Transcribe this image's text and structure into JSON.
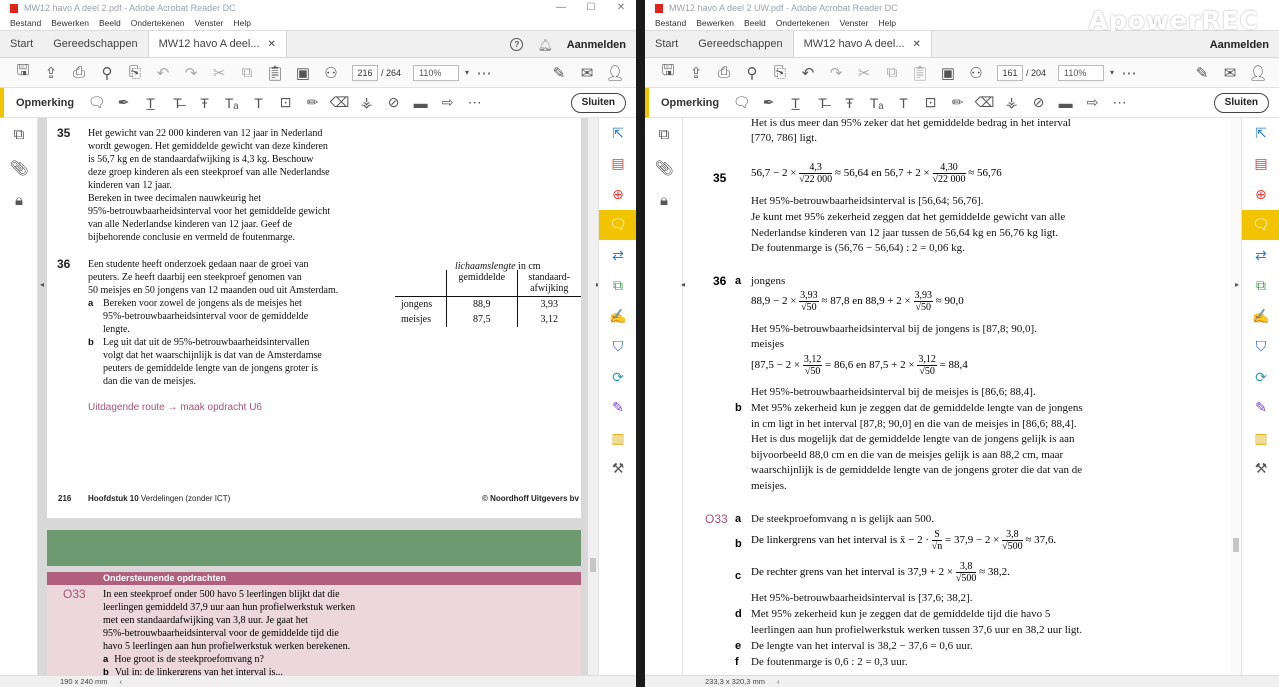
{
  "left_window": {
    "title": "MW12 havo A deel 2.pdf - Adobe Acrobat Reader DC",
    "menu": [
      "Bestand",
      "Bewerken",
      "Beeld",
      "Ondertekenen",
      "Venster",
      "Help"
    ],
    "tabs": {
      "start": "Start",
      "tools": "Gereedschappen",
      "doc": "MW12 havo A deel..."
    },
    "login": "Aanmelden",
    "page_current": "216",
    "page_total": "/ 264",
    "zoom": "110%",
    "annot_label": "Opmerking",
    "close_label": "Sluiten",
    "status_size": "190 x 240 mm",
    "page": {
      "q35_num": "35",
      "q35_text": [
        "Het gewicht van 22 000 kinderen van 12 jaar in Nederland",
        "wordt gewogen. Het gemiddelde gewicht van deze kinderen",
        "is 56,7 kg en de standaardafwijking is 4,3 kg. Beschouw",
        "deze groep kinderen als een steekproef van alle Nederlandse",
        "kinderen van 12 jaar.",
        "Bereken in twee decimalen nauwkeurig het",
        "95%-betrouwbaarheidsinterval voor het gemiddelde gewicht",
        "van alle Nederlandse kinderen van 12 jaar. Geef de",
        "bijbehorende conclusie en vermeld de foutenmarge."
      ],
      "q36_num": "36",
      "q36_text": [
        "Een studente heeft onderzoek gedaan naar de groei van",
        "peuters. Ze heeft daarbij een steekproef genomen van",
        "50 meisjes en 50 jongens van 12 maanden oud uit Amsterdam."
      ],
      "q36a_label": "a",
      "q36a_text": [
        "Bereken voor zowel de jongens als de meisjes het",
        "95%-betrouwbaarheidsinterval voor de gemiddelde",
        "lengte."
      ],
      "q36b_label": "b",
      "q36b_text": [
        "Leg uit dat uit de 95%-betrouwbaarheidsintervallen",
        "volgt dat het waarschijnlijk is dat van de Amsterdamse",
        "peuters de gemiddelde lengte van de jongens groter is",
        "dan die van de meisjes."
      ],
      "table": {
        "caption_italic": "lichaamslengte",
        "caption_rest": " in cm",
        "col1": "gemiddelde",
        "col2": "standaard-",
        "col2b": "afwijking",
        "rows": [
          {
            "label": "jongens",
            "mean": "88,9",
            "sd": "3,93"
          },
          {
            "label": "meisjes",
            "mean": "87,5",
            "sd": "3,12"
          }
        ]
      },
      "route_text": "Uitdagende route → maak opdracht U6",
      "footer_page": "216",
      "footer_chapter_bold": "Hoofdstuk 10",
      "footer_chapter_rest": " Verdelingen (zonder ICT)",
      "footer_publisher": "© Noordhoff Uitgevers bv"
    },
    "o033": {
      "header": "Ondersteunende opdrachten",
      "num": "O33",
      "text": [
        "In een steekproef onder 500 havo 5 leerlingen blijkt dat die",
        "leerlingen gemiddeld 37,9 uur aan hun profielwerkstuk werken",
        "met een standaardafwijking van 3,8 uur. Je gaat het",
        "95%-betrouwbaarheidsinterval voor de gemiddelde tijd die",
        "havo 5 leerlingen aan hun profielwerkstuk werken berekenen."
      ],
      "a_label": "a",
      "a_text": "Hoe groot is de steekproefomvang n?",
      "b_label": "b",
      "b_text": "Vul in: de linkergrens van het interval is..."
    }
  },
  "right_window": {
    "title": "MW12 havo A deel 2 UW.pdf - Adobe Acrobat Reader DC",
    "watermark": "ApowerREC",
    "menu": [
      "Bestand",
      "Bewerken",
      "Beeld",
      "Ondertekenen",
      "Venster",
      "Help"
    ],
    "tabs": {
      "start": "Start",
      "tools": "Gereedschappen",
      "doc": "MW12 havo A deel..."
    },
    "login": "Aanmelden",
    "page_current": "161",
    "page_total": "/ 204",
    "zoom": "110%",
    "annot_label": "Opmerking",
    "close_label": "Sluiten",
    "status_size": "233,3 x 320,3 mm",
    "answers": {
      "top1": "Het is dus meer dan 95% zeker dat het gemiddelde bedrag in het interval",
      "top2": "[770, 786] ligt.",
      "a35_num": "35",
      "a35_math_a": "56,7 − 2 ×",
      "a35_n1": "4,3",
      "a35_d1": "√22 000",
      "a35_math_b": "≈ 56,64 en 56,7 + 2 ×",
      "a35_n2": "4,30",
      "a35_d2": "√22 000",
      "a35_math_c": "≈ 56,76",
      "a35_l1": "Het 95%-betrouwbaarheidsinterval is [56,64; 56,76].",
      "a35_l2": "Je kunt met 95% zekerheid zeggen dat het gemiddelde gewicht van alle",
      "a35_l3": "Nederlandse kinderen van 12 jaar tussen de 56,64 kg en 56,76 kg ligt.",
      "a35_l4": "De foutenmarge is (56,76 − 56,64) : 2 = 0,06 kg.",
      "a36_num": "36",
      "a36a_label": "a",
      "a36a_jongens": "jongens",
      "a36j_a": "88,9 − 2 ×",
      "a36j_n1": "3,93",
      "a36j_d1": "√50",
      "a36j_b": "≈ 87,8 en 88,9 + 2 ×",
      "a36j_n2": "3,93",
      "a36j_d2": "√50",
      "a36j_c": "≈ 90,0",
      "a36j_res": "Het 95%-betrouwbaarheidsinterval bij de jongens is [87,8; 90,0].",
      "a36_meisjes": "meisjes",
      "a36m_a": "[87,5 − 2 ×",
      "a36m_n1": "3,12",
      "a36m_d1": "√50",
      "a36m_b": "= 86,6 en 87,5 + 2 ×",
      "a36m_n2": "3,12",
      "a36m_d2": "√50",
      "a36m_c": "= 88,4",
      "a36m_res": "Het 95%-betrouwbaarheidsinterval bij de meisjes is [86,6; 88,4].",
      "a36b_label": "b",
      "a36b_text": [
        "Met 95% zekerheid kun je zeggen dat de gemiddelde lengte van de jongens",
        "in cm ligt in het interval [87,8; 90,0] en die van de meisjes in [86,6; 88,4].",
        "Het is dus mogelijk dat de gemiddelde lengte van de jongens gelijk is aan",
        "bijvoorbeeld 88,0 cm en die van de meisjes gelijk is aan 88,2 cm, maar",
        "waarschijnlijk is de gemiddelde lengte van de jongens groter die dat van de",
        "meisjes."
      ],
      "o33_num": "O33",
      "o33a_label": "a",
      "o33a_text": "De steekproefomvang n is gelijk aan 500.",
      "o33b_label": "b",
      "o33b_a": "De linkergrens van het interval is x̄ − 2 ·",
      "o33b_n1": "S",
      "o33b_d1": "√n",
      "o33b_b": "= 37,9 − 2 ×",
      "o33b_n2": "3,8",
      "o33b_d2": "√500",
      "o33b_c": "≈ 37,6.",
      "o33c_label": "c",
      "o33c_a": "De rechter grens van het interval is 37,9 + 2 ×",
      "o33c_n": "3,8",
      "o33c_d": "√500",
      "o33c_b": "≈ 38,2.",
      "o33c_res": "Het 95%-betrouwbaarheidsinterval is [37,6; 38,2].",
      "o33d_label": "d",
      "o33d_text": [
        "Met 95% zekerheid kun je zeggen dat de gemiddelde tijd die havo 5",
        "leerlingen aan hun profielwerkstuk werken tussen 37,6 uur en 38,2 uur ligt."
      ],
      "o33e_label": "e",
      "o33e_text": "De lengte van het interval is 38,2 − 37,6 = 0,6 uur.",
      "o33f_label": "f",
      "o33f_text": "De foutenmarge is 0,6 : 2 = 0,3 uur."
    }
  }
}
